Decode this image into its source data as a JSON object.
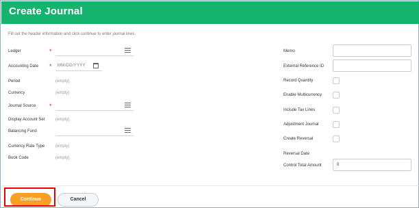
{
  "header": {
    "title": "Create Journal"
  },
  "intro": "Fill out the header information and click continue to enter journal lines.",
  "left_fields": {
    "ledger": {
      "label": "Ledger"
    },
    "accounting_date": {
      "label": "Accounting Date",
      "placeholder": "MM/DD/YYYY"
    },
    "period": {
      "label": "Period",
      "value": "(empty)"
    },
    "currency": {
      "label": "Currency",
      "value": "(empty)"
    },
    "journal_source": {
      "label": "Journal Source"
    },
    "display_account_set": {
      "label": "Display Account Set",
      "value": "(empty)"
    },
    "balancing_fund": {
      "label": "Balancing Fund"
    },
    "currency_rate_type": {
      "label": "Currency Rate Type",
      "value": "(empty)"
    },
    "book_code": {
      "label": "Book Code",
      "value": "(empty)"
    }
  },
  "right_fields": {
    "memo": {
      "label": "Memo"
    },
    "external_reference_id": {
      "label": "External Reference ID"
    },
    "record_quantity": {
      "label": "Record Quantity",
      "checked": false
    },
    "enable_multicurrency": {
      "label": "Enable Multicurrency",
      "checked": false
    },
    "include_tax_lines": {
      "label": "Include Tax Lines",
      "checked": false
    },
    "adjustment_journal": {
      "label": "Adjustment Journal",
      "checked": false
    },
    "create_reversal": {
      "label": "Create Reversal",
      "checked": false
    },
    "reversal_date": {
      "label": "Reversal Date"
    },
    "control_total_amount": {
      "label": "Control Total Amount",
      "value": "0"
    }
  },
  "required_marker": "*",
  "buttons": {
    "continue": "Continue",
    "cancel": "Cancel"
  },
  "colors": {
    "header": "#16b36f",
    "continue": "#f7a025",
    "required": "#d9281b",
    "highlight": "#e60000"
  },
  "icons": {
    "prompt": "list-icon",
    "date": "calendar-icon"
  }
}
